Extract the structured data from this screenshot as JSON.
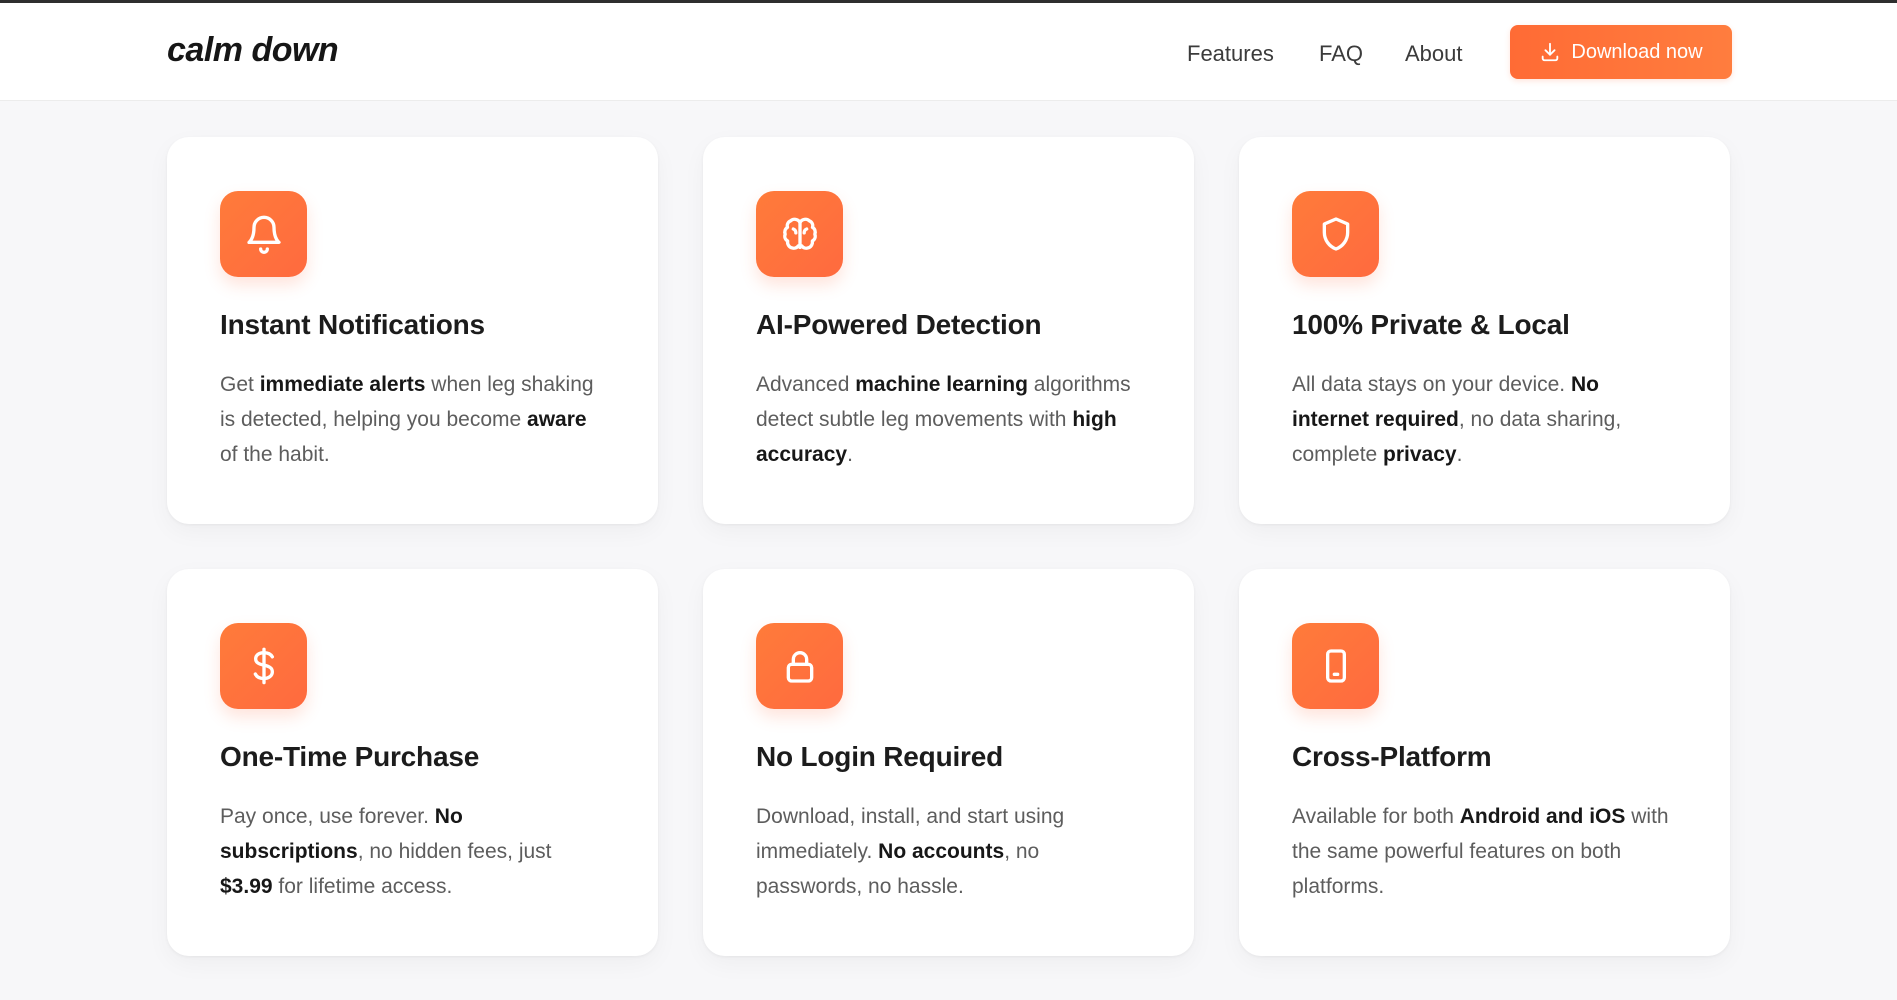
{
  "header": {
    "logo": "calm down",
    "nav": [
      {
        "label": "Features"
      },
      {
        "label": "FAQ"
      },
      {
        "label": "About"
      }
    ],
    "download_label": "Download now"
  },
  "cards": [
    {
      "title": "Instant Notifications",
      "icon": "bell-icon",
      "desc": [
        "Get ",
        "immediate alerts",
        " when leg shaking is detected, helping you become ",
        "aware",
        " of the habit."
      ]
    },
    {
      "title": "AI-Powered Detection",
      "icon": "brain-icon",
      "desc": [
        "Advanced ",
        "machine learning",
        " algorithms detect subtle leg movements with ",
        "high accuracy",
        "."
      ]
    },
    {
      "title": "100% Private & Local",
      "icon": "shield-icon",
      "desc": [
        "All data stays on your device. ",
        "No internet required",
        ", no data sharing, complete ",
        "privacy",
        "."
      ]
    },
    {
      "title": "One-Time Purchase",
      "icon": "dollar-icon",
      "desc": [
        "Pay once, use forever. ",
        "No subscriptions",
        ", no hidden fees, just ",
        "$3.99",
        " for lifetime access."
      ]
    },
    {
      "title": "No Login Required",
      "icon": "lock-icon",
      "desc": [
        "Download, install, and start using immediately. ",
        "No accounts",
        ", no passwords, no hassle."
      ]
    },
    {
      "title": "Cross-Platform",
      "icon": "tablet-icon",
      "desc": [
        "Available for both ",
        "Android and iOS",
        " with the same powerful features on both platforms."
      ]
    }
  ],
  "colors": {
    "accent": "#ff6b35",
    "accent_light": "#ff7d3e",
    "background": "#f7f7f9",
    "card": "#ffffff"
  }
}
